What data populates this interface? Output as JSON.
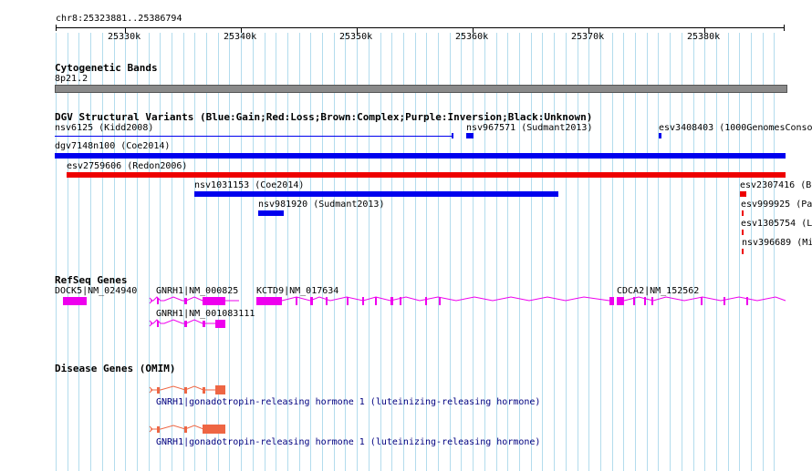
{
  "ruler": {
    "location": "chr8:25323881..25386794",
    "ticks": [
      "25330k",
      "25340k",
      "25350k",
      "25360k",
      "25370k",
      "25380k"
    ]
  },
  "tracks": {
    "cytoband": {
      "title": "Cytogenetic Bands",
      "band": "8p21.2"
    },
    "dgv": {
      "title": "DGV Structural Variants (Blue:Gain;Red:Loss;Brown:Complex;Purple:Inversion;Black:Unknown)",
      "features": [
        "nsv6125 (Kidd2008)",
        "nsv967571 (Sudmant2013)",
        "esv3408403 (1000GenomesConso",
        "dgv7148n100 (Coe2014)",
        "esv2759606 (Redon2006)",
        "nsv1031153 (Coe2014)",
        "esv2307416 (Bo",
        "nsv981920 (Sudmant2013)",
        "esv999925 (Pa",
        "esv1305754 (L",
        "nsv396689 (Mi"
      ]
    },
    "refseq": {
      "title": "RefSeq Genes",
      "genes": [
        "DOCK5|NM_024940",
        "GNRH1|NM_000825",
        "KCTD9|NM_017634",
        "CDCA2|NM_152562",
        "GNRH1|NM_001083111"
      ]
    },
    "omim": {
      "title": "Disease Genes (OMIM)",
      "genes": [
        "GNRH1|gonadotropin-releasing hormone 1 (luteinizing-releasing hormone)",
        "GNRH1|gonadotropin-releasing hormone 1 (luteinizing-releasing hormone)"
      ]
    }
  },
  "colors": {
    "gain": "#0000ee",
    "loss": "#ee0000",
    "refseq": "#ee00ee",
    "omim": "#ee6644",
    "grid": "#b3dced"
  }
}
